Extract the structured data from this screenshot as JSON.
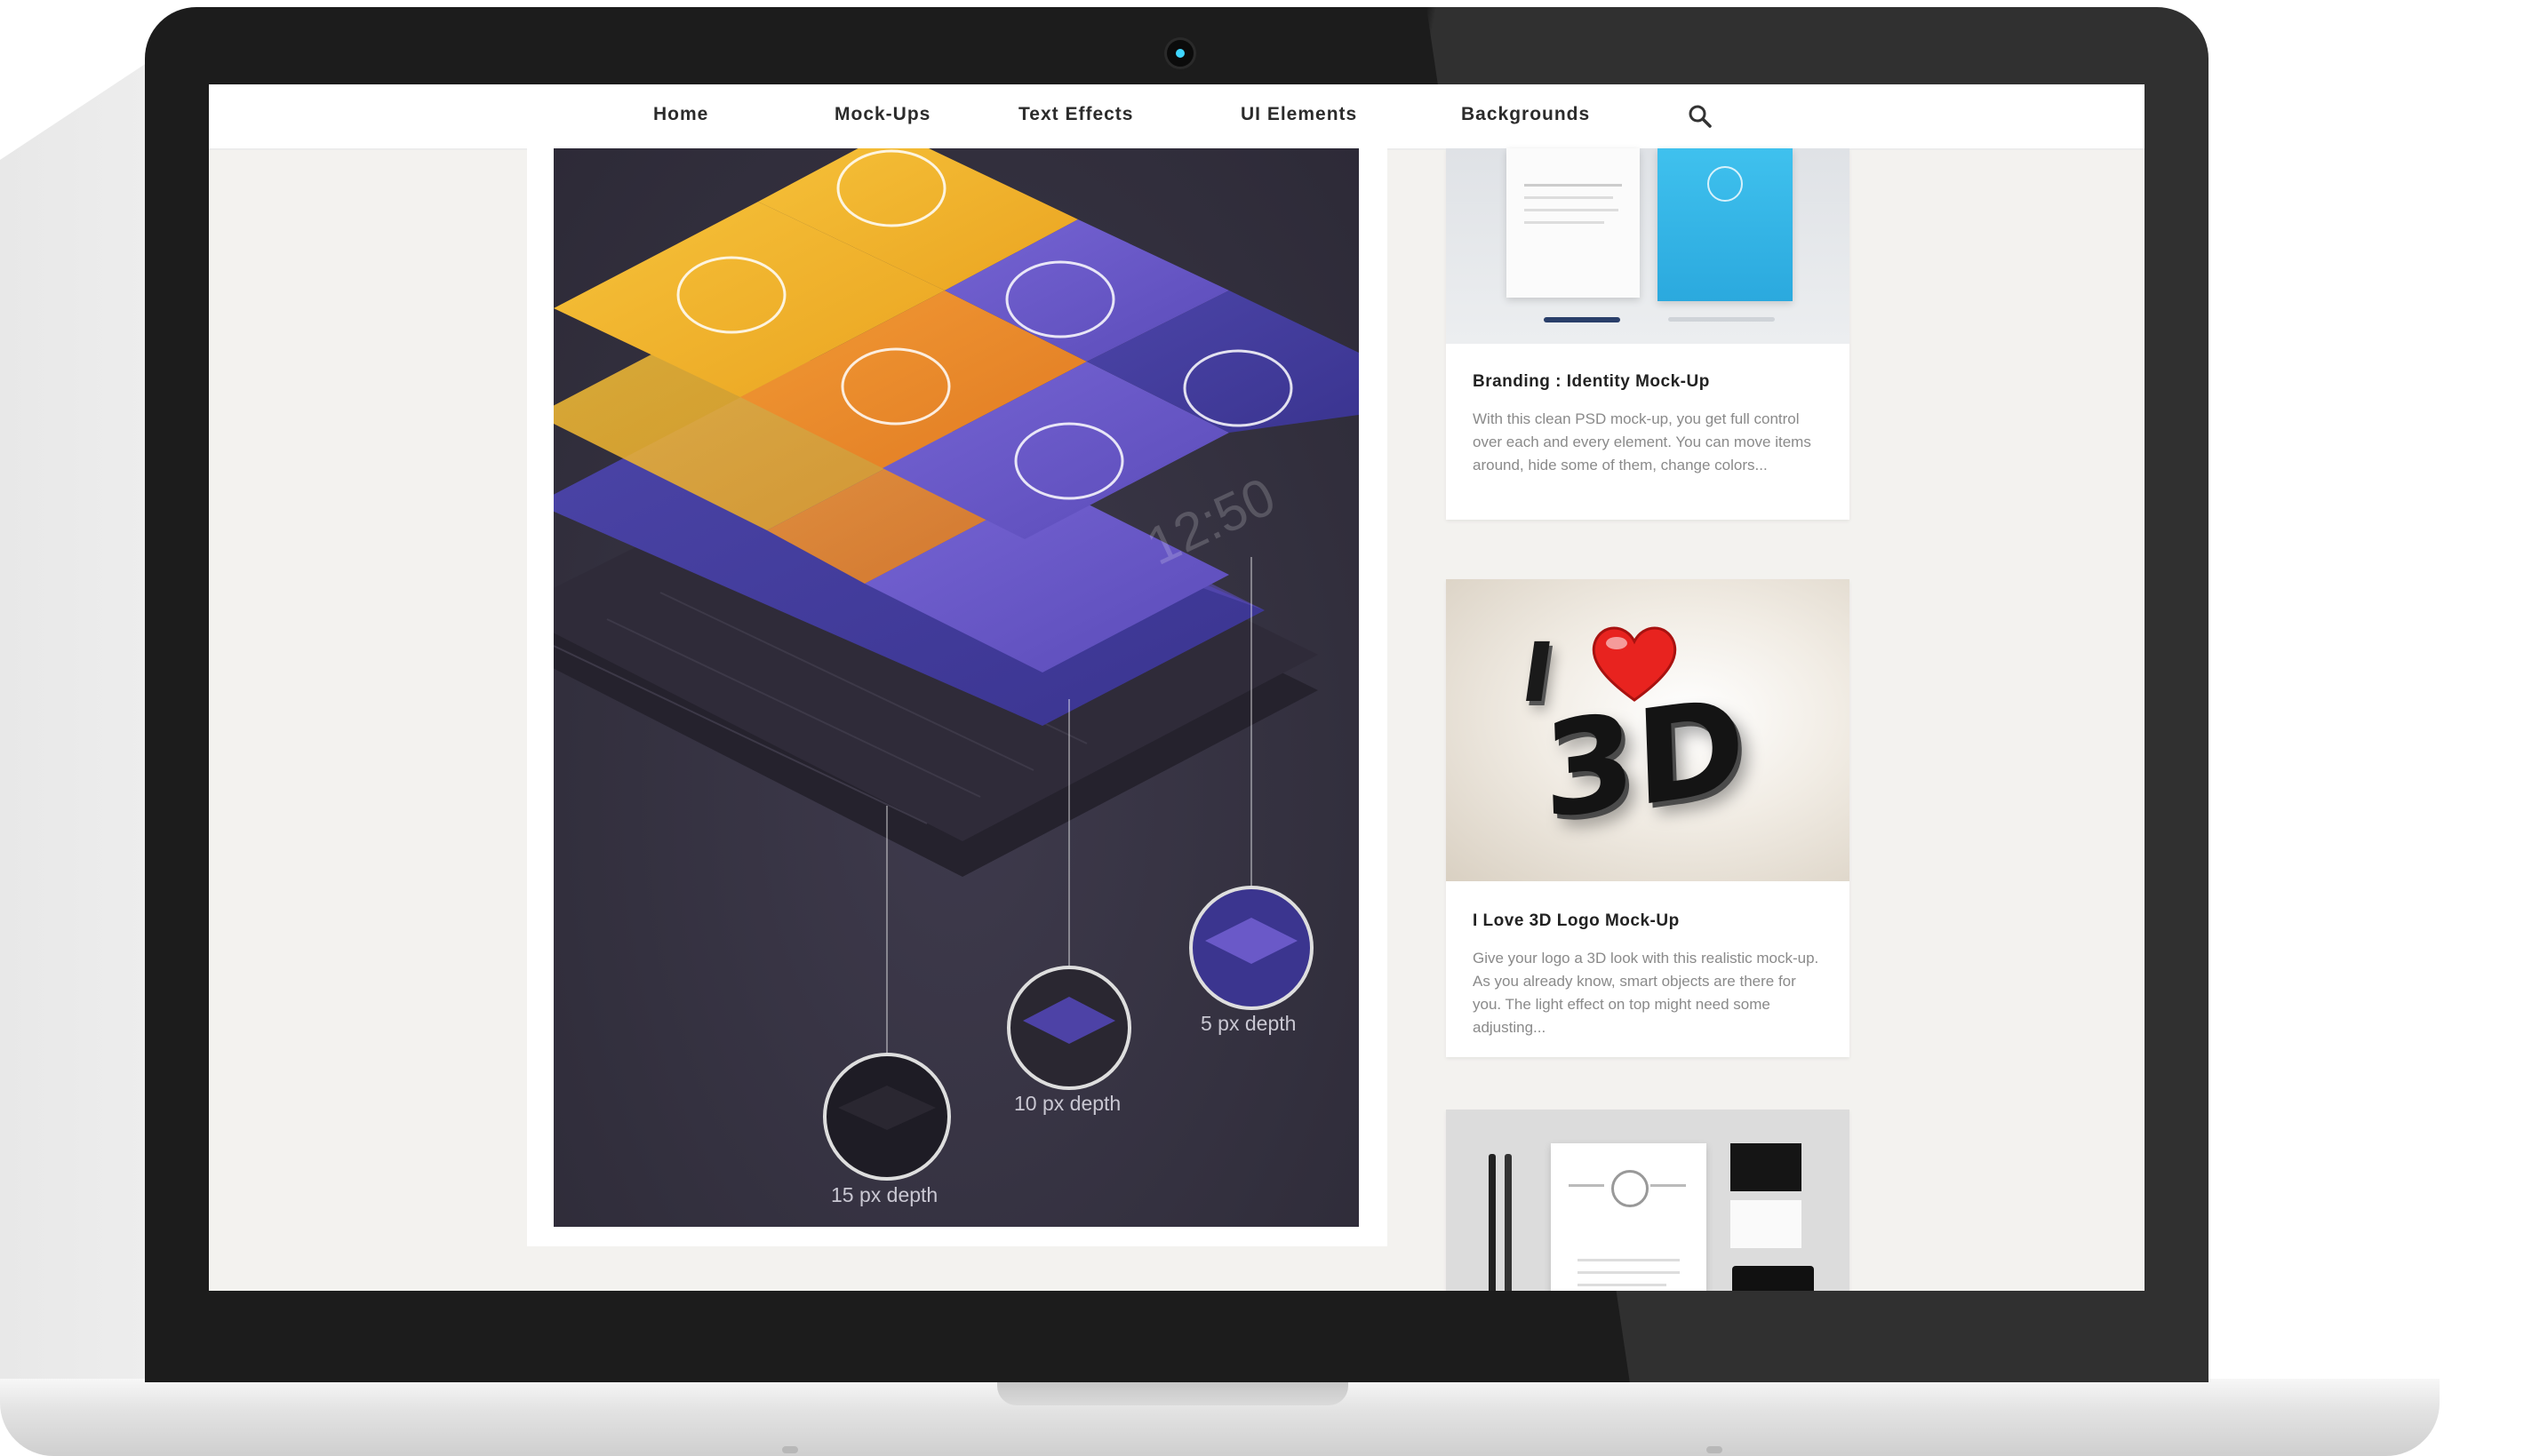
{
  "nav": {
    "items": [
      "Home",
      "Mock-Ups",
      "Text Effects",
      "UI Elements",
      "Backgrounds"
    ]
  },
  "article": {
    "depth_labels": [
      "15 px depth",
      "10 px depth",
      "5 px depth"
    ],
    "big_time": "12:50"
  },
  "sidebar": {
    "cards": [
      {
        "title": "Branding : Identity Mock-Up",
        "desc": "With this clean PSD mock-up, you get full control over each and every element. You can move items around, hide some of them, change colors..."
      },
      {
        "title": "I Love 3D Logo Mock-Up",
        "desc": "Give your logo a 3D look with this realistic mock-up. As you already know, smart objects are there for you. The light effect on top might need some adjusting...",
        "logo_text_top": "I",
        "logo_text_bottom": "3D"
      }
    ]
  },
  "colors": {
    "accent_camera": "#3fd6ff",
    "tile_yellow": "#f4b52c",
    "tile_orange": "#ee8a2b",
    "tile_purple": "#6a59c8",
    "tile_dark_purple": "#4a3fa5",
    "image_bg": "#35313f"
  }
}
